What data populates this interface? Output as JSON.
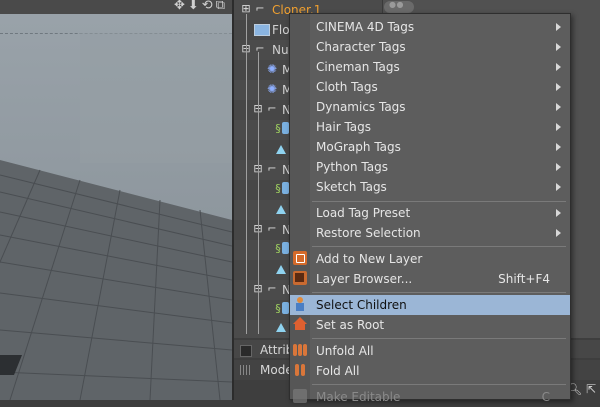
{
  "viewport": {
    "toolbar_icons": [
      "move-icon",
      "arrow-down-icon",
      "rotate-icon",
      "maximize-icon"
    ]
  },
  "object_manager": {
    "objects": [
      {
        "name": "Cloner.1",
        "icon": "cloner-icon",
        "highlighted": true
      },
      {
        "name": "Floo",
        "icon": "floor-icon"
      },
      {
        "name": "Nul",
        "icon": "null-icon"
      },
      {
        "name": "M",
        "icon": "mograph-effector-icon"
      },
      {
        "name": "M",
        "icon": "mograph-effector-icon"
      },
      {
        "name": "N",
        "icon": "null-icon"
      },
      {
        "name": "",
        "icon": "spring-cone-icon"
      },
      {
        "name": "N",
        "icon": "null-icon"
      },
      {
        "name": "",
        "icon": "spring-cone-icon"
      },
      {
        "name": "N",
        "icon": "null-icon"
      },
      {
        "name": "",
        "icon": "spring-cone-icon"
      },
      {
        "name": "N",
        "icon": "null-icon"
      },
      {
        "name": "",
        "icon": "spring-cone-icon"
      }
    ]
  },
  "attributes": {
    "tab_label": "Attrib",
    "mode_label": "Mode"
  },
  "context_menu": {
    "items": [
      {
        "label": "CINEMA 4D Tags",
        "submenu": true
      },
      {
        "label": "Character Tags",
        "submenu": true
      },
      {
        "label": "Cineman Tags",
        "submenu": true
      },
      {
        "label": "Cloth Tags",
        "submenu": true
      },
      {
        "label": "Dynamics Tags",
        "submenu": true
      },
      {
        "label": "Hair Tags",
        "submenu": true
      },
      {
        "label": "MoGraph Tags",
        "submenu": true
      },
      {
        "label": "Python Tags",
        "submenu": true
      },
      {
        "label": "Sketch Tags",
        "submenu": true
      },
      {
        "label": "Load Tag Preset",
        "submenu": true
      },
      {
        "label": "Restore Selection",
        "submenu": true
      },
      {
        "label": "Add to New Layer",
        "icon": "layer-add-icon"
      },
      {
        "label": "Layer Browser...",
        "shortcut": "Shift+F4",
        "icon": "layer-browser-icon"
      },
      {
        "label": "Select Children",
        "icon": "select-children-icon",
        "selected": true
      },
      {
        "label": "Set as Root",
        "icon": "set-root-icon"
      },
      {
        "label": "Unfold All",
        "icon": "unfold-all-icon"
      },
      {
        "label": "Fold All",
        "icon": "fold-all-icon"
      },
      {
        "label": "Make Editable",
        "shortcut": "C",
        "icon": "make-editable-icon",
        "disabled": true
      }
    ]
  },
  "colors": {
    "menu_bg": "#5d5d5d",
    "menu_selected": "#9bb6d6",
    "cloner_highlight": "#f0a030",
    "viewport_bg": "#8e979e"
  }
}
